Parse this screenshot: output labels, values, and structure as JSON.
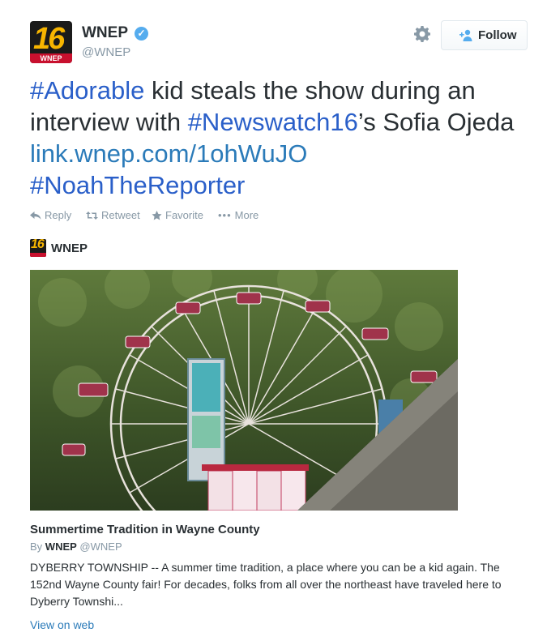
{
  "author": {
    "logo_number": "16",
    "logo_text": "WNEP",
    "name": "WNEP",
    "handle": "@WNEP",
    "verified_mark": "✓"
  },
  "follow_button": {
    "label": "Follow"
  },
  "tweet": {
    "parts": [
      {
        "text": "#Adorable",
        "kind": "hashtag"
      },
      {
        "text": " kid steals the show during an interview with ",
        "kind": "text"
      },
      {
        "text": "#Newswatch16",
        "kind": "hashtag"
      },
      {
        "text": "’s Sofia Ojeda ",
        "kind": "text"
      },
      {
        "text": "link.wnep.com/1ohWuJO",
        "kind": "link"
      },
      {
        "text": " ",
        "kind": "text"
      },
      {
        "text": "#NoahTheReporter",
        "kind": "hashtag"
      }
    ]
  },
  "actions": {
    "reply": "Reply",
    "retweet": "Retweet",
    "favorite": "Favorite",
    "more": "More"
  },
  "card": {
    "brand": "WNEP",
    "logo_number": "16",
    "title": "Summertime Tradition in Wayne County",
    "by_prefix": "By",
    "by_name": "WNEP",
    "by_handle": "@WNEP",
    "description": "DYBERRY TOWNSHIP --  A summer time tradition, a place where you can be a kid again. The 152nd Wayne County fair! For decades, folks from all over the northeast have traveled here to Dyberry Townshi...",
    "view_link": "View on web"
  },
  "colors": {
    "link": "#2b7bb9",
    "text": "#292f33",
    "muted": "#8899a6",
    "verified": "#55acee"
  },
  "icons": {
    "settings": "gear-icon",
    "follow": "add-user-icon",
    "reply": "reply-icon",
    "retweet": "retweet-icon",
    "favorite": "star-icon",
    "more": "ellipsis-icon"
  }
}
